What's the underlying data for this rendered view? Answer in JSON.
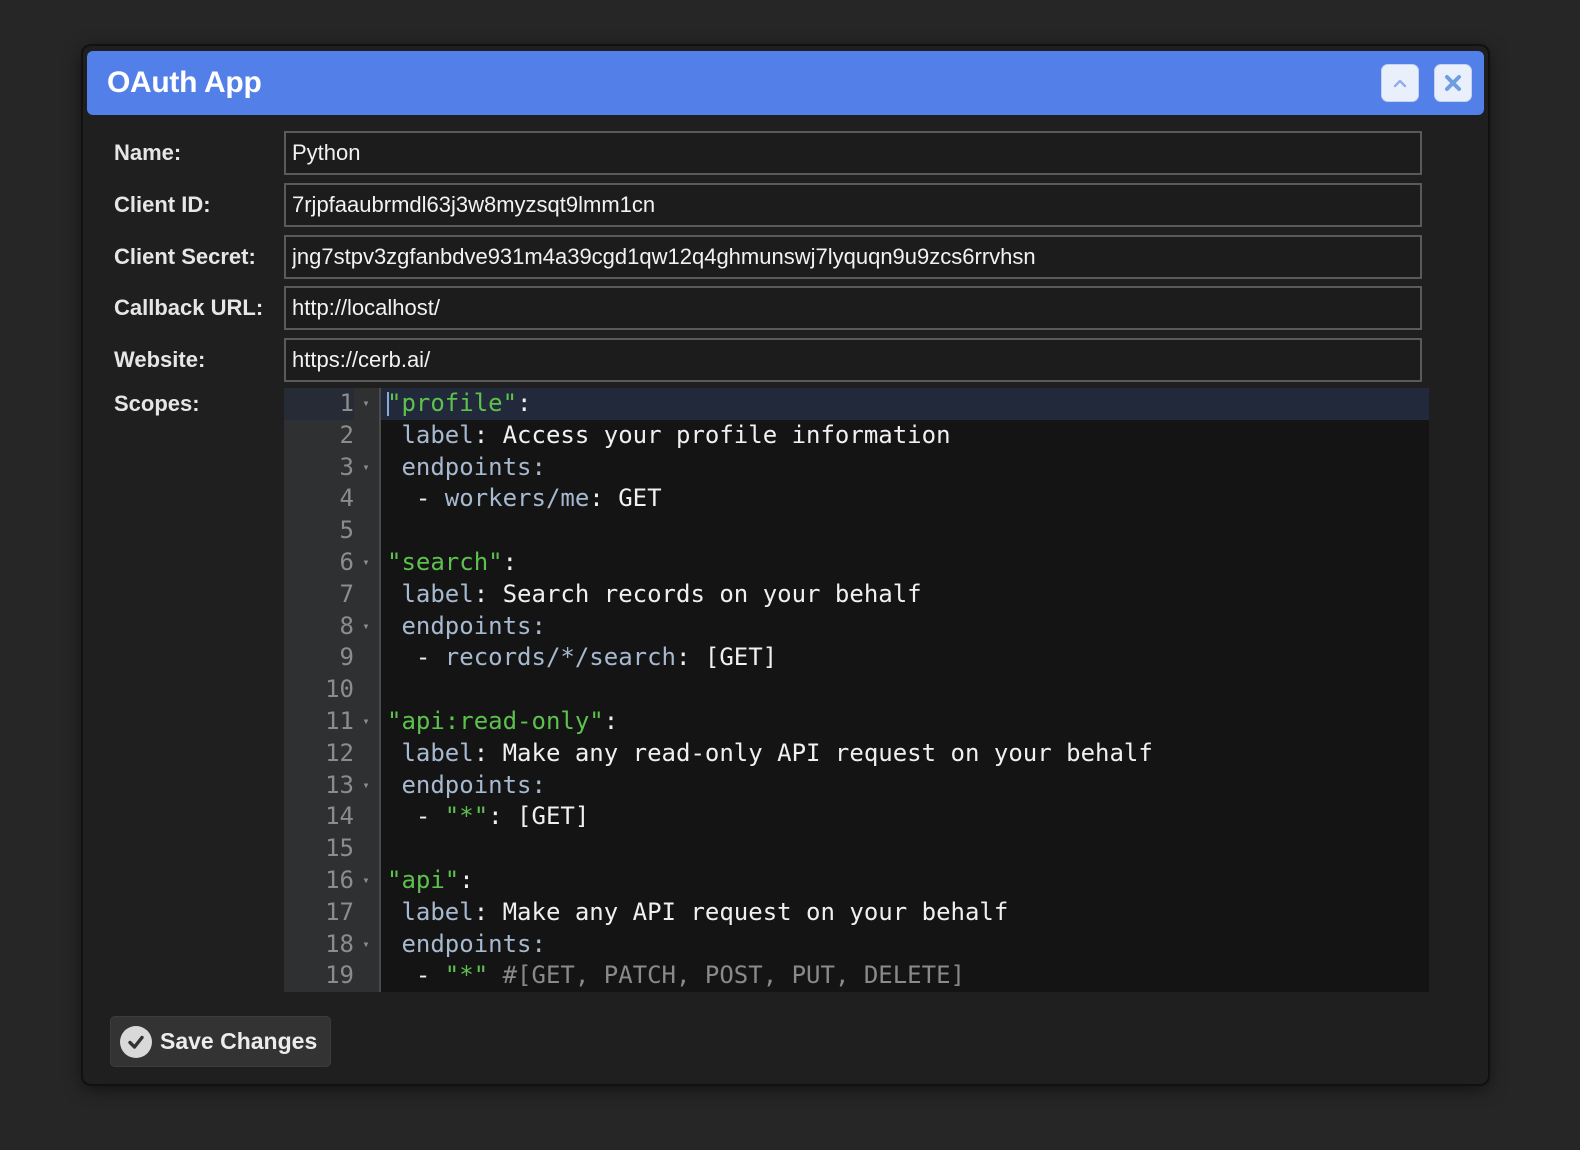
{
  "dialog": {
    "title": "OAuth App",
    "collapse_icon": "chevron-up-icon",
    "close_icon": "close-icon"
  },
  "form": {
    "name": {
      "label": "Name:",
      "value": "Python"
    },
    "client_id": {
      "label": "Client ID:",
      "value": "7rjpfaaubrmdl63j3w8myzsqt9lmm1cn"
    },
    "client_secret": {
      "label": "Client Secret:",
      "value": "jng7stpv3zgfanbdve931m4a39cgd1qw12q4ghmunswj7lyquqn9u9zcs6rrvhsn"
    },
    "callback_url": {
      "label": "Callback URL:",
      "value": "http://localhost/"
    },
    "website": {
      "label": "Website:",
      "value": "https://cerb.ai/"
    },
    "scopes": {
      "label": "Scopes:"
    }
  },
  "editor": {
    "lines": [
      {
        "num": "1",
        "fold": true,
        "tokens": [
          {
            "t": "\"profile\"",
            "c": "str"
          },
          {
            "t": ":",
            "c": "p"
          }
        ]
      },
      {
        "num": "2",
        "fold": false,
        "tokens": [
          {
            "t": " label",
            "c": "key"
          },
          {
            "t": ": Access your profile information",
            "c": "p"
          }
        ]
      },
      {
        "num": "3",
        "fold": true,
        "tokens": [
          {
            "t": " endpoints",
            "c": "key"
          },
          {
            "t": ":",
            "c": "key"
          }
        ]
      },
      {
        "num": "4",
        "fold": false,
        "tokens": [
          {
            "t": "  - ",
            "c": "p"
          },
          {
            "t": "workers/me",
            "c": "key"
          },
          {
            "t": ": GET",
            "c": "p"
          }
        ]
      },
      {
        "num": "5",
        "fold": false,
        "tokens": []
      },
      {
        "num": "6",
        "fold": true,
        "tokens": [
          {
            "t": "\"search\"",
            "c": "str"
          },
          {
            "t": ":",
            "c": "p"
          }
        ]
      },
      {
        "num": "7",
        "fold": false,
        "tokens": [
          {
            "t": " label",
            "c": "key"
          },
          {
            "t": ": Search records on your behalf",
            "c": "p"
          }
        ]
      },
      {
        "num": "8",
        "fold": true,
        "tokens": [
          {
            "t": " endpoints",
            "c": "key"
          },
          {
            "t": ":",
            "c": "key"
          }
        ]
      },
      {
        "num": "9",
        "fold": false,
        "tokens": [
          {
            "t": "  - ",
            "c": "p"
          },
          {
            "t": "records/*/search",
            "c": "key"
          },
          {
            "t": ": [GET]",
            "c": "p"
          }
        ]
      },
      {
        "num": "10",
        "fold": false,
        "tokens": []
      },
      {
        "num": "11",
        "fold": true,
        "tokens": [
          {
            "t": "\"api:read-only\"",
            "c": "str"
          },
          {
            "t": ":",
            "c": "p"
          }
        ]
      },
      {
        "num": "12",
        "fold": false,
        "tokens": [
          {
            "t": " label",
            "c": "key"
          },
          {
            "t": ": Make any read-only API request on your behalf",
            "c": "p"
          }
        ]
      },
      {
        "num": "13",
        "fold": true,
        "tokens": [
          {
            "t": " endpoints",
            "c": "key"
          },
          {
            "t": ":",
            "c": "key"
          }
        ]
      },
      {
        "num": "14",
        "fold": false,
        "tokens": [
          {
            "t": "  - ",
            "c": "p"
          },
          {
            "t": "\"*\"",
            "c": "str"
          },
          {
            "t": ": [GET]",
            "c": "p"
          }
        ]
      },
      {
        "num": "15",
        "fold": false,
        "tokens": []
      },
      {
        "num": "16",
        "fold": true,
        "tokens": [
          {
            "t": "\"api\"",
            "c": "str"
          },
          {
            "t": ":",
            "c": "p"
          }
        ]
      },
      {
        "num": "17",
        "fold": false,
        "tokens": [
          {
            "t": " label",
            "c": "key"
          },
          {
            "t": ": Make any API request on your behalf",
            "c": "p"
          }
        ]
      },
      {
        "num": "18",
        "fold": true,
        "tokens": [
          {
            "t": " endpoints",
            "c": "key"
          },
          {
            "t": ":",
            "c": "key"
          }
        ]
      },
      {
        "num": "19",
        "fold": false,
        "tokens": [
          {
            "t": "  - ",
            "c": "p"
          },
          {
            "t": "\"*\"",
            "c": "str"
          },
          {
            "t": " #[GET, PATCH, POST, PUT, DELETE]",
            "c": "com"
          }
        ]
      }
    ],
    "active_line": 1
  },
  "footer": {
    "save_label": "Save Changes",
    "save_icon": "check-circle-icon"
  },
  "colors": {
    "titlebar": "#5380e8",
    "string": "#5dc14d",
    "key": "#a7b9cf"
  }
}
